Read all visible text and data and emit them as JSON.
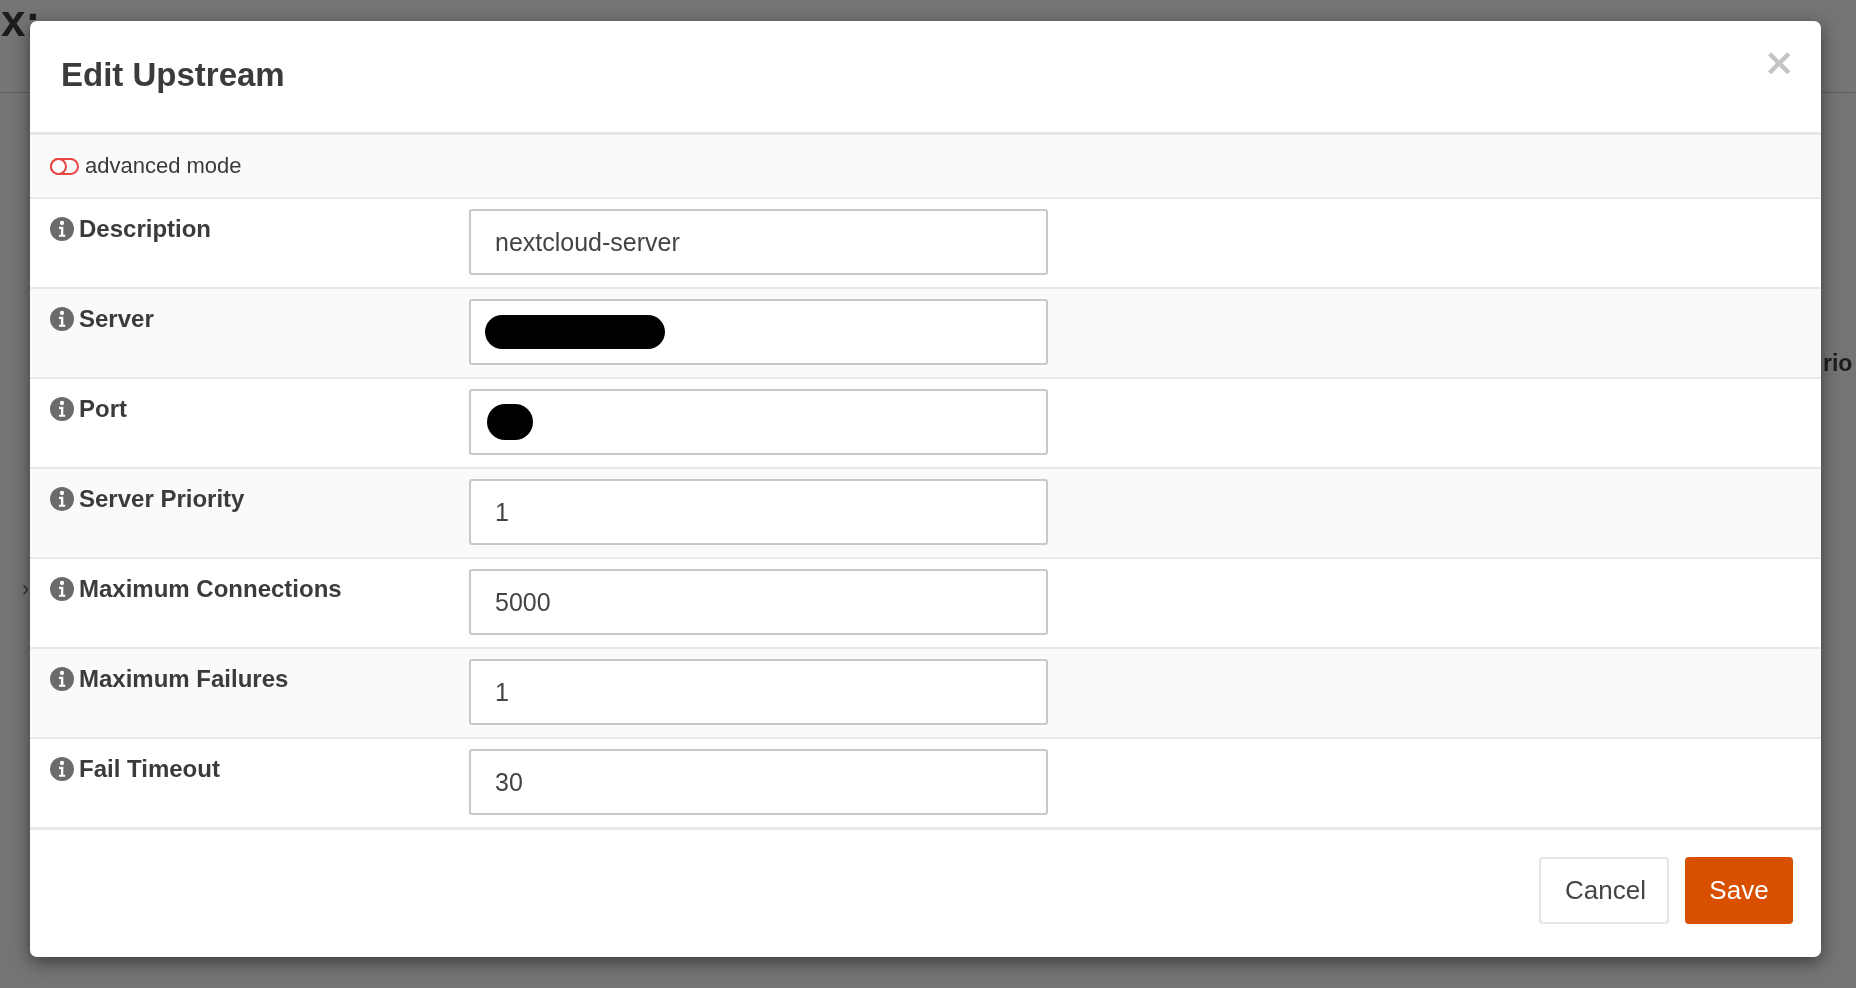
{
  "background_page": {
    "title": "x:",
    "side_text": "rio",
    "row_chevron": "›"
  },
  "dialog": {
    "title": "Edit Upstream",
    "close": "×",
    "advanced_mode": {
      "label": "advanced mode",
      "on": false
    },
    "fields": [
      {
        "label": "Description",
        "value": "nextcloud-server"
      },
      {
        "label": "Server",
        "redacted": true
      },
      {
        "label": "Port",
        "redacted": true
      },
      {
        "label": "Server Priority",
        "value": "1"
      },
      {
        "label": "Maximum Connections",
        "value": "5000"
      },
      {
        "label": "Maximum Failures",
        "value": "1"
      },
      {
        "label": "Fail Timeout",
        "value": "30"
      }
    ],
    "buttons": [
      {
        "label": "Cancel",
        "kind": "secondary"
      },
      {
        "label": "Save",
        "kind": "primary"
      }
    ]
  }
}
